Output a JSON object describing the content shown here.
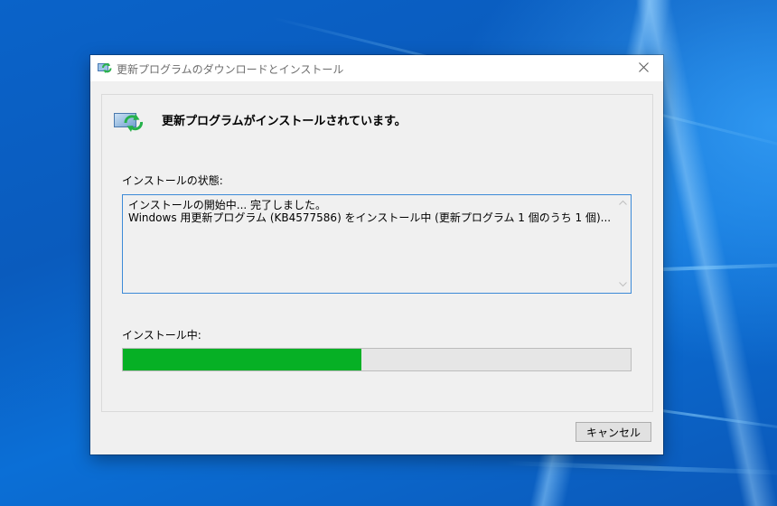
{
  "window": {
    "title": "更新プログラムのダウンロードとインストール"
  },
  "header": {
    "message": "更新プログラムがインストールされています。",
    "icon": "windows-update-icon"
  },
  "status": {
    "label": "インストールの状態:",
    "lines": [
      "インストールの開始中... 完了しました。",
      "Windows 用更新プログラム (KB4577586) をインストール中 (更新プログラム 1 個のうち 1 個)..."
    ]
  },
  "progress": {
    "label": "インストール中:",
    "percent": 47
  },
  "buttons": {
    "cancel_label": "キャンセル"
  },
  "colors": {
    "progress_fill": "#06b025",
    "focus_border": "#3c8ad7",
    "desktop_blue": "#0a63c9"
  }
}
